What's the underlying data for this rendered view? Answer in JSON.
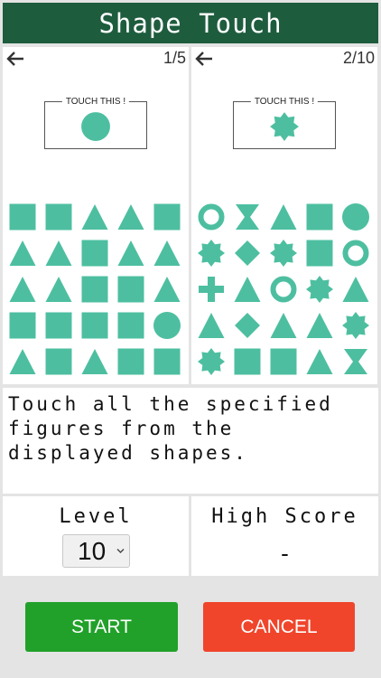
{
  "app": {
    "title": "Shape Touch"
  },
  "colors": {
    "shape": "#4dbfa0",
    "header": "#1e5c3e",
    "start": "#21a12a",
    "cancel": "#f0452b"
  },
  "previews": [
    {
      "counter": "1/5",
      "target_label": "TOUCH THIS !",
      "target_shape": "circle",
      "grid": [
        [
          "square",
          "square",
          "triangle",
          "triangle",
          "square"
        ],
        [
          "triangle",
          "triangle",
          "square",
          "triangle",
          "triangle"
        ],
        [
          "triangle",
          "triangle",
          "square",
          "square",
          "triangle"
        ],
        [
          "square",
          "square",
          "square",
          "square",
          "circle"
        ],
        [
          "triangle",
          "square",
          "triangle",
          "square",
          "square"
        ]
      ]
    },
    {
      "counter": "2/10",
      "target_label": "TOUCH THIS !",
      "target_shape": "star",
      "grid": [
        [
          "ring",
          "hourglass",
          "triangle",
          "square",
          "circle"
        ],
        [
          "star",
          "diamond",
          "star",
          "square",
          "ring"
        ],
        [
          "cross",
          "triangle",
          "ring",
          "star",
          "triangle"
        ],
        [
          "triangle",
          "diamond",
          "triangle",
          "triangle",
          "star"
        ],
        [
          "star",
          "square",
          "square",
          "triangle",
          "hourglass"
        ]
      ]
    }
  ],
  "instruction": "Touch all the specified figures from the displayed shapes.",
  "level": {
    "label": "Level",
    "value": "10"
  },
  "high_score": {
    "label": "High Score",
    "value": "-"
  },
  "buttons": {
    "start": "START",
    "cancel": "CANCEL"
  }
}
